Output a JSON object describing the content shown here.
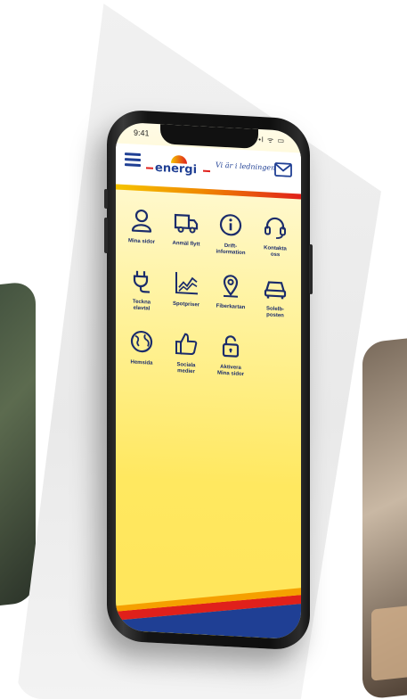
{
  "status_bar": {
    "time": "9:41",
    "icons": "••l ᯤ ▭"
  },
  "header": {
    "logo_text": "energi",
    "tagline": "Vi är i ledningen",
    "menu_icon": "hamburger-icon",
    "mail_icon": "mail-icon"
  },
  "colors": {
    "brand_blue": "#1f3f94",
    "yellow": "#ffe55a",
    "red": "#e0201b",
    "orange": "#f08a00"
  },
  "tiles": [
    {
      "label": "Mina sidor",
      "icon": "user-icon"
    },
    {
      "label": "Anmäl flytt",
      "icon": "truck-icon"
    },
    {
      "label": "Drift-\ninformation",
      "icon": "info-icon"
    },
    {
      "label": "Kontakta\noss",
      "icon": "headset-icon"
    },
    {
      "label": "Teckna\nelavtal",
      "icon": "plug-icon"
    },
    {
      "label": "Spotpriser",
      "icon": "chart-icon"
    },
    {
      "label": "Fiberkartan",
      "icon": "map-pin-icon"
    },
    {
      "label": "Solelb-\nposten",
      "icon": "car-icon"
    },
    {
      "label": "Hemsida",
      "icon": "globe-icon"
    },
    {
      "label": "Sociala\nmedier",
      "icon": "thumbs-up-icon"
    },
    {
      "label": "Aktivera\nMina sidor",
      "icon": "unlock-icon"
    }
  ]
}
